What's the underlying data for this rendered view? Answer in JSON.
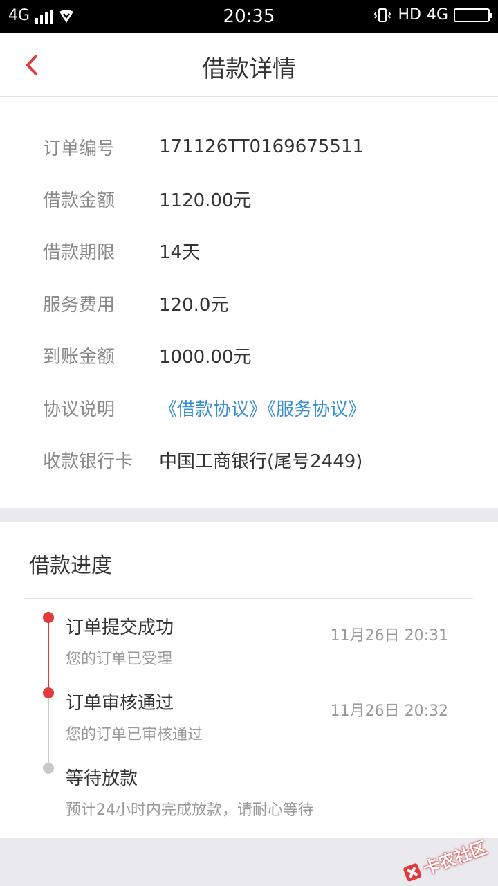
{
  "status_bar": {
    "network": "4G",
    "time": "20:35",
    "hd": "HD",
    "net2": "4G"
  },
  "header": {
    "title": "借款详情"
  },
  "details": [
    {
      "label": "订单编号",
      "value": "171126TT0169675511"
    },
    {
      "label": "借款金额",
      "value": "1120.00元"
    },
    {
      "label": "借款期限",
      "value": "14天"
    },
    {
      "label": "服务费用",
      "value": "120.0元"
    },
    {
      "label": "到账金额",
      "value": "1000.00元"
    },
    {
      "label": "协议说明",
      "value": "《借款协议》《服务协议》"
    },
    {
      "label": "收款银行卡",
      "value": "中国工商银行(尾号2449)"
    }
  ],
  "progress": {
    "title": "借款进度",
    "steps": [
      {
        "title": "订单提交成功",
        "desc": "您的订单已受理",
        "time": "11月26日 20:31"
      },
      {
        "title": "订单审核通过",
        "desc": "您的订单已审核通过",
        "time": "11月26日 20:32"
      },
      {
        "title": "等待放款",
        "desc": "预计24小时内完成放款，请耐心等待",
        "time": ""
      }
    ]
  },
  "watermark": "卡农社区",
  "colors": {
    "accent_red": "#e23b3b",
    "link_blue": "#3a8fd1",
    "pending_gray": "#c8c8c8"
  }
}
